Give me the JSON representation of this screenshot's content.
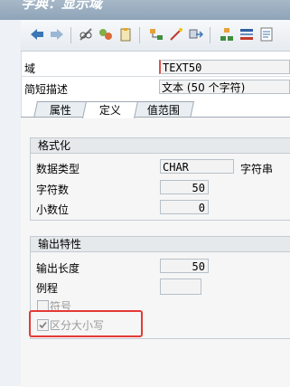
{
  "window": {
    "title": "字典：显示域"
  },
  "toolbar": {
    "icons": [
      "back-icon",
      "forward-icon",
      "glasses-icon",
      "other-object-icon",
      "clipboard-icon",
      "hierarchy-icon",
      "magic-wand-icon",
      "transport-icon",
      "tree-icon",
      "list-icon",
      "info-icon"
    ]
  },
  "header": {
    "domain_label": "域",
    "domain_value": "TEXT50",
    "desc_label": "简短描述",
    "desc_value": "文本 (50 个字符)"
  },
  "tabs": [
    {
      "label": "属性"
    },
    {
      "label": "定义"
    },
    {
      "label": "值范围"
    }
  ],
  "format": {
    "title": "格式化",
    "datatype_label": "数据类型",
    "datatype_value": "CHAR",
    "datatype_desc": "字符串",
    "chars_label": "字符数",
    "chars_value": "50",
    "decimals_label": "小数位",
    "decimals_value": "0"
  },
  "output": {
    "title": "输出特性",
    "length_label": "输出长度",
    "length_value": "50",
    "routine_label": "例程",
    "routine_value": "",
    "sign_label": "符号",
    "case_label": "区分大小写",
    "case_checked": true
  },
  "colors": {
    "highlight": "#e53935",
    "title_bar": "#9aaec1"
  }
}
